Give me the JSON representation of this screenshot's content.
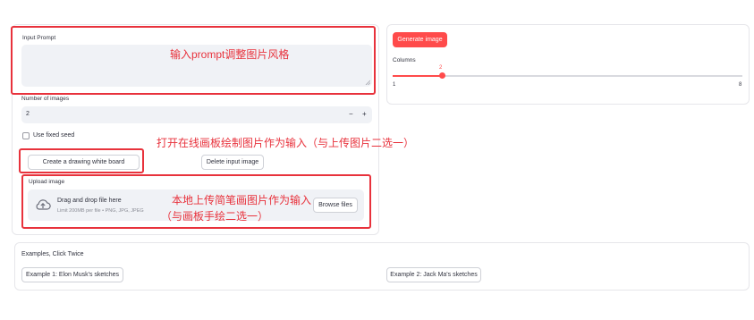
{
  "prompt": {
    "label": "Input Prompt",
    "placeholder_annotation": "输入prompt调整图片风格"
  },
  "num_images": {
    "label": "Number of images",
    "value": "2",
    "minus": "−",
    "plus": "+"
  },
  "fixed_seed": {
    "label": "Use fixed seed",
    "checked": false
  },
  "buttons": {
    "drawing_board": "Create a drawing white board",
    "delete_image": "Delete input image",
    "generate": "Generate image",
    "browse": "Browse files"
  },
  "annotations": {
    "drawing_board": "打开在线画板绘制图片作为输入（与上传图片二选一）",
    "upload_line1": "本地上传简笔画图片作为输入",
    "upload_line2": "（与画板手绘二选一）"
  },
  "upload": {
    "label": "Upload image",
    "title": "Drag and drop file here",
    "hint": "Limit 200MB per file • PNG, JPG, JPEG"
  },
  "columns": {
    "label": "Columns",
    "value": 2,
    "min": "1",
    "max": "8",
    "value_label": "2"
  },
  "examples": {
    "label": "Examples, Click Twice",
    "items": [
      "Example 1: Elon Musk's sketches",
      "Example 2: Jack Ma's sketches"
    ]
  },
  "colors": {
    "accent": "#ff4b4b",
    "annotation": "#e8323c",
    "input_bg": "#f0f2f6"
  },
  "icons": [
    "cloud-upload-icon",
    "resize-grip-icon",
    "checkbox-icon",
    "slider-thumb"
  ]
}
